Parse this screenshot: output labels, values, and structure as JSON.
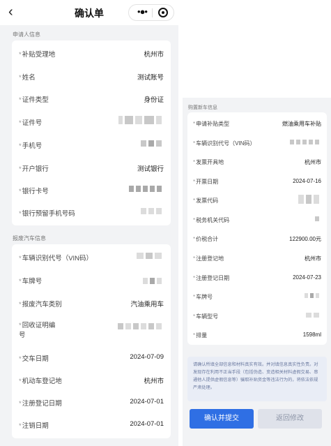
{
  "nav": {
    "back_icon": "chevron-left-icon",
    "title": "确认单",
    "more_icon": "more-dots-icon",
    "close_icon": "target-circle-icon"
  },
  "applicant": {
    "section_title": "申请人信息",
    "rows": [
      {
        "label": "补贴受理地",
        "value": "杭州市"
      },
      {
        "label": "姓名",
        "value": "测试账号"
      },
      {
        "label": "证件类型",
        "value": "身份证"
      },
      {
        "label": "证件号",
        "value": ""
      },
      {
        "label": "手机号",
        "value": ""
      },
      {
        "label": "开户银行",
        "value": "测试银行"
      },
      {
        "label": "银行卡号",
        "value": ""
      },
      {
        "label": "银行预留手机号码",
        "value": ""
      }
    ]
  },
  "scrap": {
    "section_title": "报废汽车信息",
    "rows": [
      {
        "label": "车辆识别代号（VIN码）",
        "value": ""
      },
      {
        "label": "车牌号",
        "value": ""
      },
      {
        "label": "报废汽车类别",
        "value": "汽油乘用车"
      },
      {
        "label_line1": "回收证明编",
        "label_line2": "号",
        "value": ""
      },
      {
        "label": "交车日期",
        "value": "2024-07-09"
      },
      {
        "label": "机动车登记地",
        "value": "杭州市"
      },
      {
        "label": "注册登记日期",
        "value": "2024-07-01"
      },
      {
        "label": "注销日期",
        "value": "2024-07-01"
      }
    ]
  },
  "newcar": {
    "section_title": "购置新车信息",
    "rows": [
      {
        "label": "申请补贴类型",
        "value": "燃油乘用车补贴"
      },
      {
        "label": "车辆识别代号（VIN码）",
        "value": ""
      },
      {
        "label": "发票开具地",
        "value": "杭州市"
      },
      {
        "label": "开票日期",
        "value": "2024-07-16"
      },
      {
        "label": "发票代码",
        "value": ""
      },
      {
        "label": "税务机关代码",
        "value": ""
      },
      {
        "label": "价税合计",
        "value": "122900.00元"
      },
      {
        "label": "注册登记地",
        "value": "杭州市"
      },
      {
        "label": "注册登记日期",
        "value": "2024-07-23"
      },
      {
        "label": "车牌号",
        "value": ""
      },
      {
        "label": "车辆型号",
        "value": ""
      },
      {
        "label": "排量",
        "value": "1598ml"
      }
    ]
  },
  "notice": "请确认所填全部信息和材料真实有效。并对填信息真实性负责。对发现存在利用不正当手段（包括伪造、变造相关材料虚假交易、串通他人提供虚假信息等）骗取补贴资金等违法行为的，将依法依规严肃处理。",
  "buttons": {
    "submit": "确认并提交",
    "back": "返回修改"
  },
  "colors": {
    "primary": "#2f6fe4",
    "secondary_bg": "#dfe2ea",
    "panel_bg": "#f2f3f5"
  }
}
